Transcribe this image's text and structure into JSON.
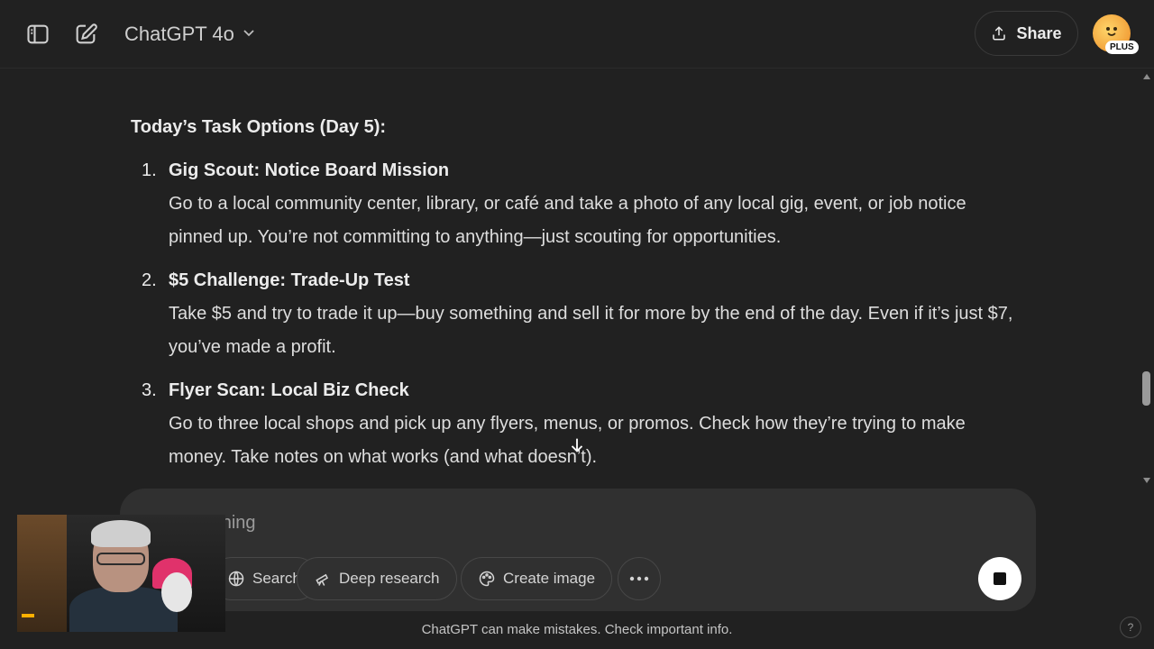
{
  "header": {
    "model_name": "ChatGPT 4o",
    "share_label": "Share",
    "plan_badge": "PLUS"
  },
  "content": {
    "heading": "Today’s Task Options (Day 5):",
    "tasks": [
      {
        "number": "1.",
        "title": "Gig Scout: Notice Board Mission",
        "description": "Go to a local community center, library, or café and take a photo of any local gig, event, or job notice pinned up. You’re not committing to anything—just scouting for opportunities."
      },
      {
        "number": "2.",
        "title": "$5 Challenge: Trade-Up Test",
        "description": "Take $5 and try to trade it up—buy something and sell it for more by the end of the day. Even if it’s just $7, you’ve made a profit."
      },
      {
        "number": "3.",
        "title": "Flyer Scan: Local Biz Check",
        "description": "Go to three local shops and pick up any flyers, menus, or promos. Check how they’re trying to make money. Take notes on what works (and what doesn’t)."
      }
    ]
  },
  "composer": {
    "placeholder": "Ask anything",
    "tools": [
      {
        "label": "Search",
        "icon": "globe-icon"
      },
      {
        "label": "Deep research",
        "icon": "telescope-icon"
      },
      {
        "label": "Create image",
        "icon": "palette-icon"
      }
    ]
  },
  "footer": {
    "disclaimer": "ChatGPT can make mistakes. Check important info.",
    "help": "?"
  },
  "colors": {
    "background": "#212121",
    "composer": "#303030",
    "text": "#ececec"
  }
}
